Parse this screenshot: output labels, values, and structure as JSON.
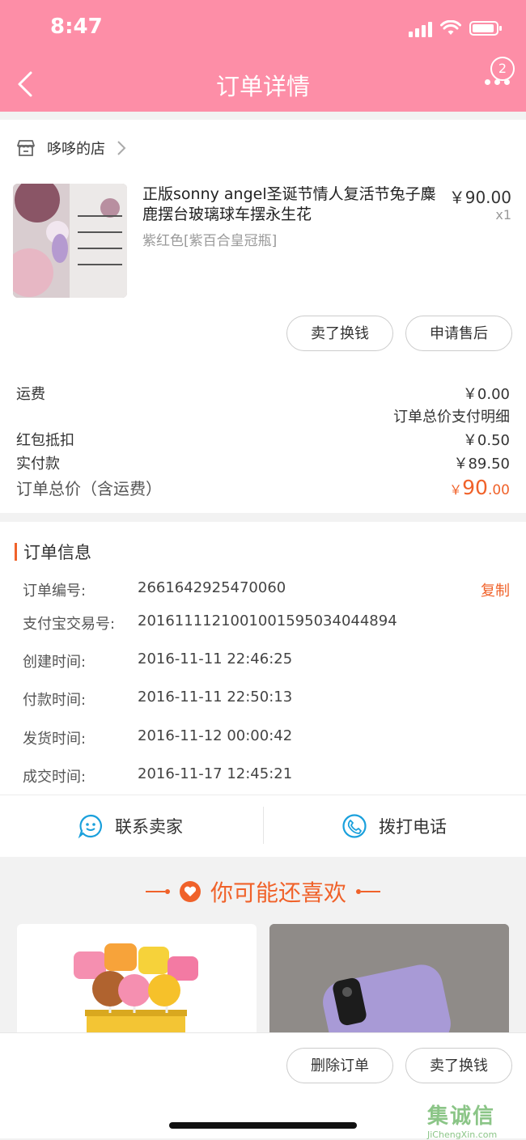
{
  "status": {
    "time": "8:47"
  },
  "nav": {
    "title": "订单详情",
    "badge": "2"
  },
  "shop": {
    "name": "哆哆的店"
  },
  "product": {
    "title": "正版sonny angel圣诞节情人复活节兔子麋鹿摆台玻璃球车摆永生花",
    "spec": "紫红色[紫百合皇冠瓶]",
    "price": "￥90.00",
    "qty": "x1"
  },
  "item_actions": {
    "sell": "卖了换钱",
    "after_sale": "申请售后"
  },
  "fees": {
    "shipping_label": "运费",
    "shipping_value": "￥0.00",
    "detail_link": "订单总价支付明细",
    "redpacket_label": "红包抵扣",
    "redpacket_value": "￥0.50",
    "paid_label": "实付款",
    "paid_value": "￥89.50",
    "total_label": "订单总价（含运费）",
    "total_currency": "￥",
    "total_int": "90",
    "total_dec": ".00"
  },
  "order_info": {
    "title": "订单信息",
    "copy_label": "复制",
    "rows": [
      {
        "label": "订单编号:",
        "value": "2661642925470060"
      },
      {
        "label": "支付宝交易号:",
        "value": "2016111121001001595034044894"
      },
      {
        "label": "创建时间:",
        "value": "2016-11-11 22:46:25"
      },
      {
        "label": "付款时间:",
        "value": "2016-11-11 22:50:13"
      },
      {
        "label": "发货时间:",
        "value": "2016-11-12 00:00:42"
      },
      {
        "label": "成交时间:",
        "value": "2016-11-17 12:45:21"
      }
    ]
  },
  "contact": {
    "seller": "联系卖家",
    "phone": "拨打电话"
  },
  "recommend": {
    "title": "你可能还喜欢"
  },
  "bottom_actions": {
    "delete": "删除订单",
    "sell": "卖了换钱"
  },
  "watermark": {
    "cn": "集诚信",
    "en": "JiChengXin.com"
  },
  "colors": {
    "header": "#fd8ea7",
    "accent": "#f0622a"
  }
}
